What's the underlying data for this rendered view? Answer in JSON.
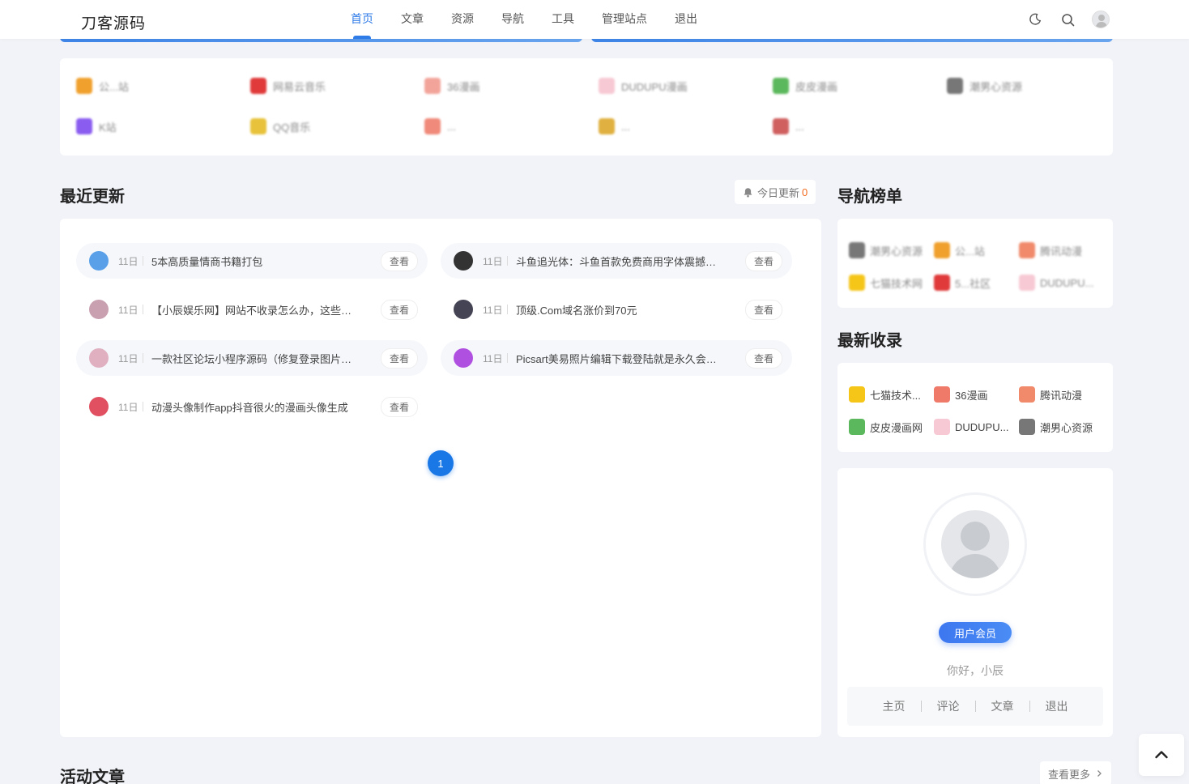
{
  "header": {
    "logo": "刀客源码",
    "nav": [
      "首页",
      "文章",
      "资源",
      "导航",
      "工具",
      "管理站点",
      "退出"
    ],
    "active_index": 0
  },
  "friend_links": {
    "items": [
      {
        "name": "公...站",
        "color": "#f0a02c"
      },
      {
        "name": "网易云音乐",
        "color": "#e03a3a"
      },
      {
        "name": "36漫画",
        "color": "#f2a49a"
      },
      {
        "name": "DUDUPU漫画",
        "color": "#f7c9d4"
      },
      {
        "name": "皮皮漫画",
        "color": "#5cb85c"
      },
      {
        "name": "潮男心资源",
        "color": "#777777"
      },
      {
        "name": "K站",
        "color": "#8a5cf0"
      },
      {
        "name": "QQ音乐",
        "color": "#e8c23a"
      },
      {
        "name": "...",
        "color": "#f08a7a"
      },
      {
        "name": "...",
        "color": "#e0b040"
      },
      {
        "name": "...",
        "color": "#d06060"
      }
    ]
  },
  "recent": {
    "title": "最近更新",
    "today_label": "今日更新",
    "today_count": "0",
    "view_label": "查看",
    "items": [
      {
        "date": "11日",
        "title": "5本高质量情商书籍打包",
        "color": "#5aa0e8"
      },
      {
        "date": "11日",
        "title": "斗鱼追光体：斗鱼首款免费商用字体震撼来袭",
        "color": "#333333"
      },
      {
        "date": "11日",
        "title": "【小辰娱乐网】网站不收录怎么办，这些方法你要知道",
        "color": "#c9a0b0"
      },
      {
        "date": "11日",
        "title": "顶级.Com域名涨价到70元",
        "color": "#444455"
      },
      {
        "date": "11日",
        "title": "一款社区论坛小程序源码（修复登录图片问题）",
        "color": "#e0b0c0"
      },
      {
        "date": "11日",
        "title": "Picsart美易照片编辑下载登陆就是永久会员版",
        "color": "#b050e0"
      },
      {
        "date": "11日",
        "title": "动漫头像制作app抖音很火的漫画头像生成",
        "color": "#e05060"
      }
    ],
    "page": "1"
  },
  "nav_rank": {
    "title": "导航榜单",
    "items": [
      {
        "name": "潮男心资源",
        "color": "#777777"
      },
      {
        "name": "公...站",
        "color": "#f0a02c"
      },
      {
        "name": "腾讯动漫",
        "color": "#f08a6a"
      },
      {
        "name": "七猫技术网",
        "color": "#f5c518"
      },
      {
        "name": "5...社区",
        "color": "#e03a3a"
      },
      {
        "name": "DUDUPU...",
        "color": "#f7c9d4"
      }
    ]
  },
  "new_sites": {
    "title": "最新收录",
    "items": [
      {
        "name": "七猫技术...",
        "color": "#f5c518"
      },
      {
        "name": "36漫画",
        "color": "#f07a6a"
      },
      {
        "name": "腾讯动漫",
        "color": "#f08a6a"
      },
      {
        "name": "皮皮漫画网",
        "color": "#5cb85c"
      },
      {
        "name": "DUDUPU...",
        "color": "#f7c9d4"
      },
      {
        "name": "潮男心资源",
        "color": "#777777"
      }
    ]
  },
  "user": {
    "member_label": "用户会员",
    "greeting": "你好，小辰",
    "menu": [
      "主页",
      "评论",
      "文章",
      "退出"
    ]
  },
  "active_posts": {
    "title": "活动文章",
    "more_label": "查看更多"
  }
}
